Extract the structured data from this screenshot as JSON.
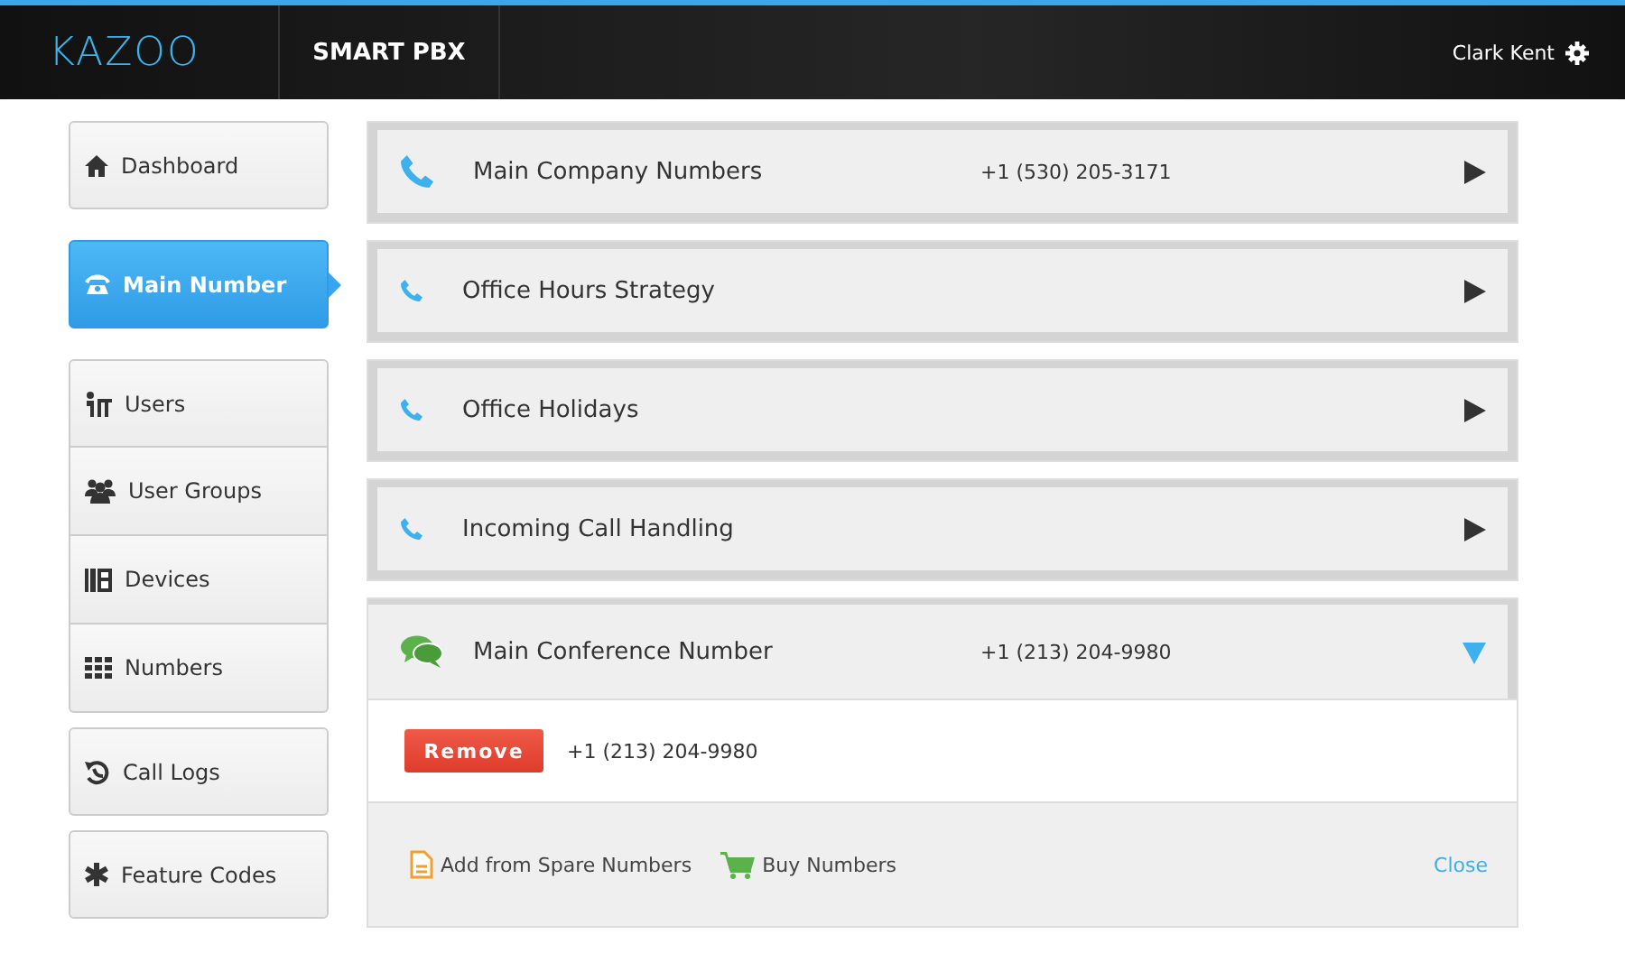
{
  "header": {
    "logo": "KAZOO",
    "app": "SMART PBX",
    "user": "Clark Kent"
  },
  "sidebar": {
    "groups": [
      {
        "items": [
          {
            "kind": "home",
            "label": "Dashboard",
            "selected": false
          }
        ]
      },
      {
        "items": [
          {
            "kind": "phone",
            "label": "Main Number",
            "selected": true
          }
        ]
      },
      {
        "items": [
          {
            "kind": "user",
            "label": "Users",
            "selected": false
          },
          {
            "kind": "group",
            "label": "User Groups",
            "selected": false
          },
          {
            "kind": "device",
            "label": "Devices",
            "selected": false
          },
          {
            "kind": "grid",
            "label": "Numbers",
            "selected": false
          }
        ]
      },
      {
        "items": [
          {
            "kind": "history",
            "label": "Call Logs",
            "selected": false
          }
        ]
      },
      {
        "items": [
          {
            "kind": "asterisk",
            "label": "Feature Codes",
            "selected": false
          }
        ]
      }
    ]
  },
  "panels": [
    {
      "kind": "phone-large",
      "title": "Main Company Numbers",
      "number": "+1 (530) 205-3171",
      "expanded": false
    },
    {
      "kind": "phone",
      "title": "Office Hours Strategy",
      "expanded": false
    },
    {
      "kind": "phone",
      "title": "Office Holidays",
      "expanded": false
    },
    {
      "kind": "phone",
      "title": "Incoming Call Handling",
      "expanded": false
    },
    {
      "kind": "chat",
      "title": "Main Conference Number",
      "number": "+1 (213) 204-9980",
      "expanded": true,
      "numbers": [
        {
          "button": "Remove",
          "number": "+1 (213) 204-9980"
        }
      ],
      "actions": [
        {
          "kind": "file",
          "label": "Add from Spare Numbers"
        },
        {
          "kind": "cart",
          "label": "Buy Numbers"
        }
      ],
      "close": "Close"
    }
  ]
}
